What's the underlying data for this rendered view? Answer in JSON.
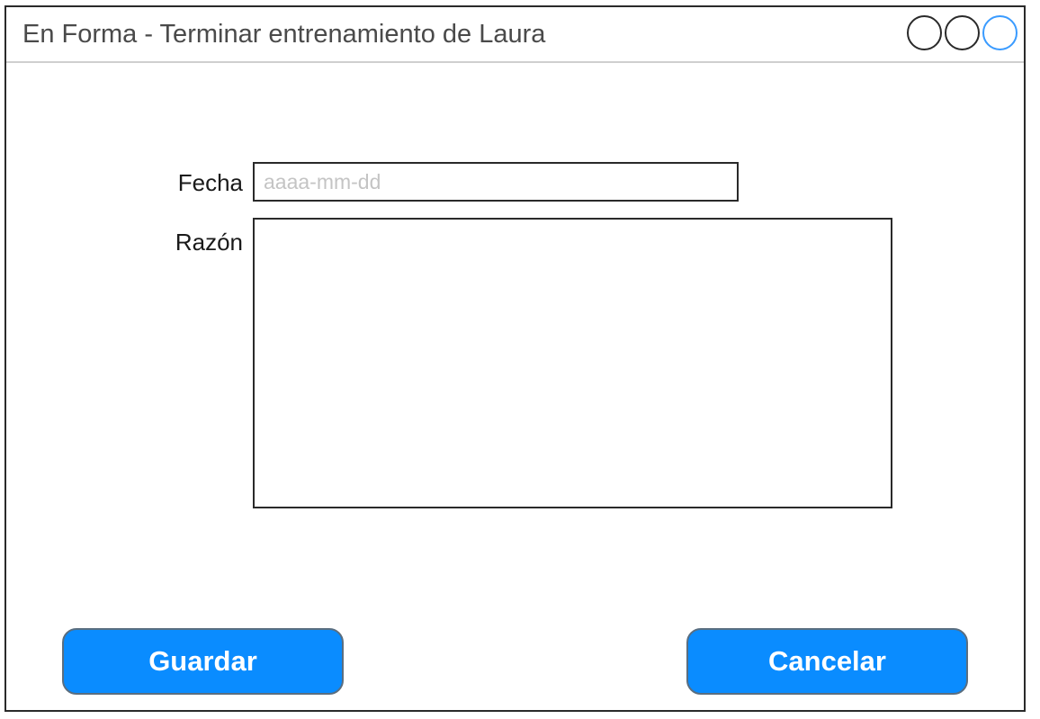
{
  "window": {
    "title": "En Forma - Terminar entrenamiento de Laura",
    "controls": [
      "window-button",
      "window-button",
      "window-button-active"
    ]
  },
  "form": {
    "date_label": "Fecha",
    "date_value": "",
    "date_placeholder": "aaaa-mm-dd",
    "reason_label": "Razón",
    "reason_value": ""
  },
  "actions": {
    "save_label": "Guardar",
    "cancel_label": "Cancelar"
  },
  "colors": {
    "button_fill": "#0a8cff",
    "active_control": "#3a9bff"
  }
}
